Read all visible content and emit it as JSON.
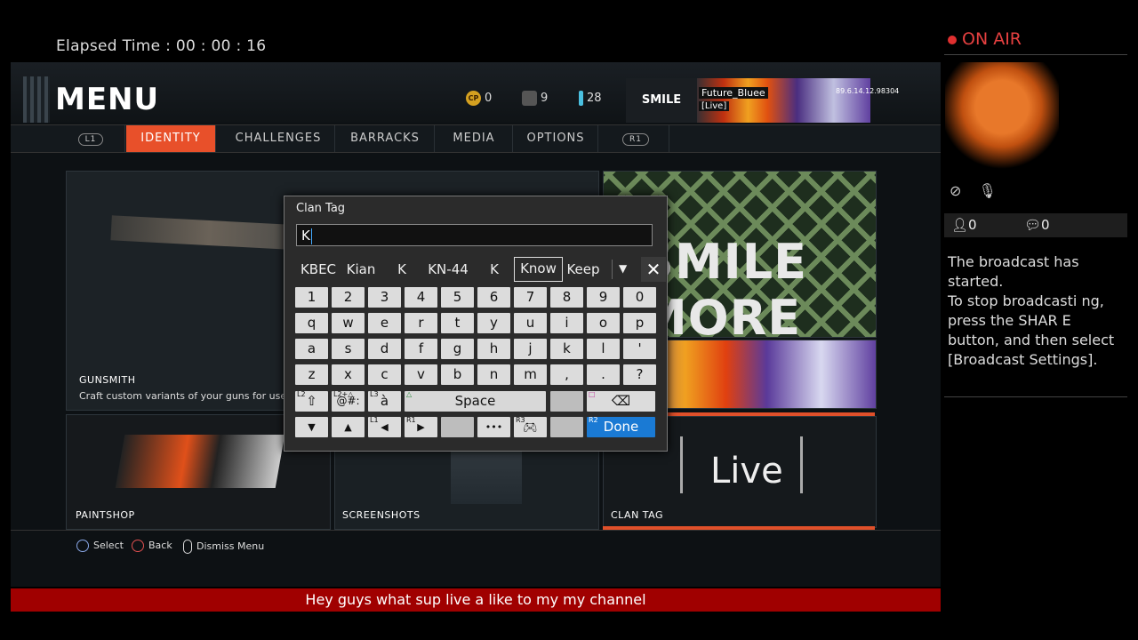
{
  "elapsed": {
    "label": "Elapsed Time :",
    "value": "00 : 00 : 16"
  },
  "game": {
    "title": "MENU",
    "stats": [
      {
        "icon": "cp-coin-icon",
        "value": "0",
        "badge": "CP"
      },
      {
        "icon": "supply-drop-icon",
        "value": "9"
      },
      {
        "icon": "vial-icon",
        "value": "28"
      }
    ],
    "banner": {
      "logo_text": "SMILE MORE",
      "player": "Future_Bluee",
      "status": "[Live]",
      "ip": "89.6.14.12.98304"
    },
    "tabs": [
      {
        "label": "L1",
        "type": "bumper"
      },
      {
        "label": "IDENTITY",
        "active": true
      },
      {
        "label": "CHALLENGES"
      },
      {
        "label": "BARRACKS"
      },
      {
        "label": "MEDIA"
      },
      {
        "label": "OPTIONS"
      },
      {
        "label": "R1",
        "type": "bumper"
      }
    ],
    "tiles": {
      "gunsmith_title": "GUNSMITH",
      "gunsmith_desc": "Craft custom variants of your guns for use in Can",
      "paintshop": "PAINTSHOP",
      "screenshots": "SCREENSHOTS",
      "clantag": "CLAN TAG",
      "emblem_text": "SMILE MORE",
      "live_text": "Live",
      "partial_s": "S"
    },
    "hints": {
      "select": "Select",
      "back": "Back",
      "dismiss": "Dismiss Menu"
    }
  },
  "keyboard": {
    "title": "Clan Tag",
    "input_value": "K",
    "suggestions": [
      "KBEC",
      "Kian",
      "K",
      "KN-44",
      "K",
      "Know",
      "Keep"
    ],
    "selected_suggestion": "Know",
    "rows": [
      [
        "1",
        "2",
        "3",
        "4",
        "5",
        "6",
        "7",
        "8",
        "9",
        "0"
      ],
      [
        "q",
        "w",
        "e",
        "r",
        "t",
        "y",
        "u",
        "i",
        "o",
        "p"
      ],
      [
        "a",
        "s",
        "d",
        "f",
        "g",
        "h",
        "j",
        "k",
        "l",
        "'"
      ],
      [
        "z",
        "x",
        "c",
        "v",
        "b",
        "n",
        "m",
        ",",
        ".",
        "?"
      ]
    ],
    "row5": {
      "shift_mod": "L2",
      "shift_label": "⇧",
      "symbols_mod": "L2+△",
      "symbols_label": "@#:",
      "accent_mod": "L3",
      "accent_label": "à",
      "space_mod": "△",
      "space_label": "Space",
      "backspace_mod": "□",
      "backspace_label": "⌫"
    },
    "row6": {
      "down": "▼",
      "up": "▲",
      "left_mod": "L1",
      "left": "◀",
      "right_mod": "R1",
      "right": "▶",
      "more": "•••",
      "controller_mod": "R3",
      "done_mod": "R2",
      "done": "Done"
    }
  },
  "side": {
    "on_air": "ON AIR",
    "viewers": "0",
    "comments": "0",
    "message": "The broadcast has started.\nTo stop broadcasti ng, press the SHAR E button, and then select [Broadcast Settings]."
  },
  "ticker": "Hey guys what sup live a like to my    my channel"
}
